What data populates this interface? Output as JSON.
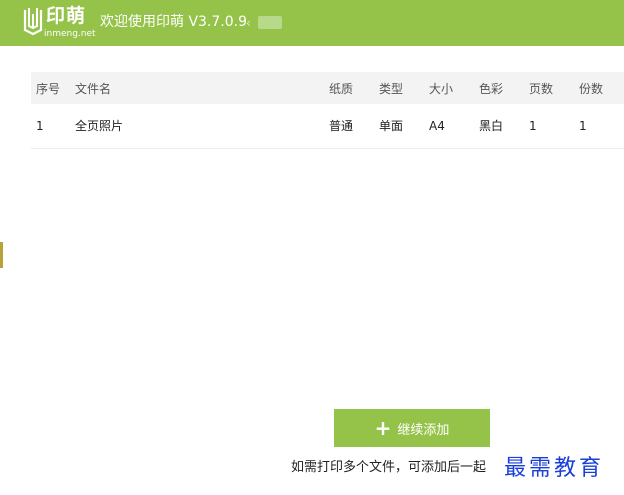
{
  "titlebar": {
    "logo_text": "印萌",
    "logo_url": "inmeng.net",
    "title": "欢迎使用印萌 V3.7.0.9",
    "colors": {
      "accent": "#95c34a"
    }
  },
  "table": {
    "headers": [
      "序号",
      "文件名",
      "纸质",
      "类型",
      "大小",
      "色彩",
      "页数",
      "份数"
    ],
    "rows": [
      [
        "1",
        "全页照片",
        "普通",
        "单面",
        "A4",
        "黑白",
        "1",
        "1"
      ]
    ]
  },
  "actions": {
    "add_label": "继续添加",
    "add_icon": "plus-icon"
  },
  "hint": "如需打印多个文件，可添加后一起",
  "watermark": "最需教育"
}
